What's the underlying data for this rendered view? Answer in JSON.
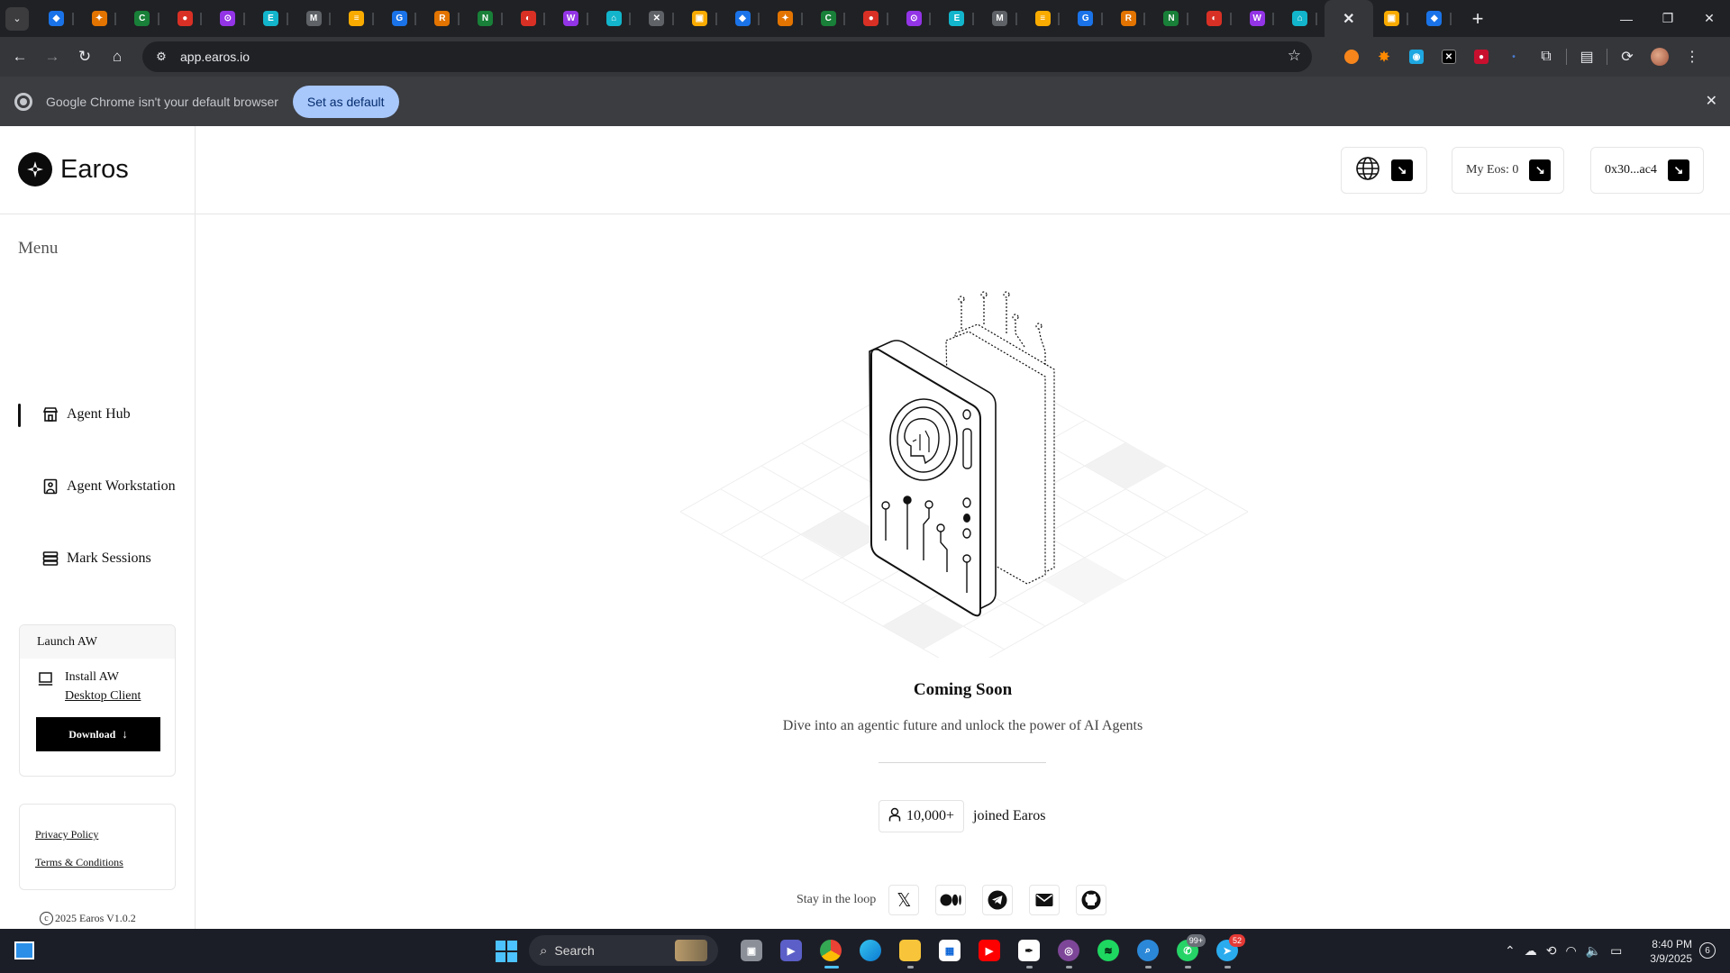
{
  "browser": {
    "tab_count": 33,
    "active_tab_icon": "close-icon",
    "url": "app.earos.io",
    "infobar": {
      "message": "Google Chrome isn't your default browser",
      "button": "Set as default"
    }
  },
  "app": {
    "brand_name": "Earos",
    "menu_title": "Menu",
    "nav": [
      {
        "label": "Agent Hub",
        "icon": "store-icon",
        "active": true
      },
      {
        "label": "Agent Workstation",
        "icon": "workstation-icon",
        "active": false
      },
      {
        "label": "Mark Sessions",
        "icon": "database-icon",
        "active": false
      }
    ],
    "launch": {
      "title": "Launch AW",
      "install_line1": "Install AW",
      "install_line2": "Desktop Client",
      "download_label": "Download"
    },
    "legal": {
      "privacy": "Privacy Policy",
      "terms": "Terms & Conditions"
    },
    "copyright": "2025 Earos  V1.0.2",
    "header": {
      "my_eos": "My Eos: 0",
      "wallet": "0x30...ac4"
    },
    "main": {
      "title": "Coming Soon",
      "subtitle": "Dive into an agentic future and unlock the power of AI Agents",
      "joined_count": "10,000+",
      "joined_text": "joined Earos",
      "social_label": "Stay in the loop"
    }
  },
  "taskbar": {
    "search_label": "Search",
    "time": "8:40 PM",
    "date": "3/9/2025",
    "notifications": "6",
    "whatsapp_badge": "99+",
    "telegram_badge": "52"
  }
}
